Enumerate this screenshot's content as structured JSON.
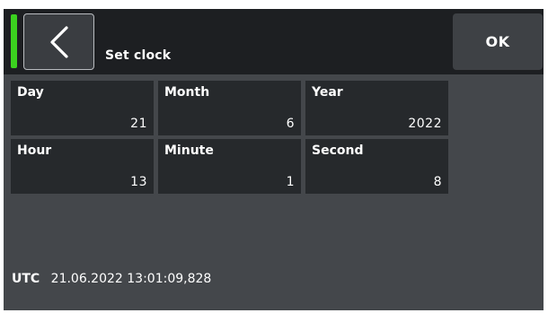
{
  "header": {
    "title": "Set clock",
    "ok_label": "OK",
    "back_icon": "chevron-left-icon",
    "status_color": "#3bd11f"
  },
  "fields": {
    "day": {
      "label": "Day",
      "value": "21"
    },
    "month": {
      "label": "Month",
      "value": "6"
    },
    "year": {
      "label": "Year",
      "value": "2022"
    },
    "hour": {
      "label": "Hour",
      "value": "13"
    },
    "minute": {
      "label": "Minute",
      "value": "1"
    },
    "second": {
      "label": "Second",
      "value": "8"
    }
  },
  "utc": {
    "label": "UTC",
    "value": "21.06.2022 13:01:09,828"
  }
}
